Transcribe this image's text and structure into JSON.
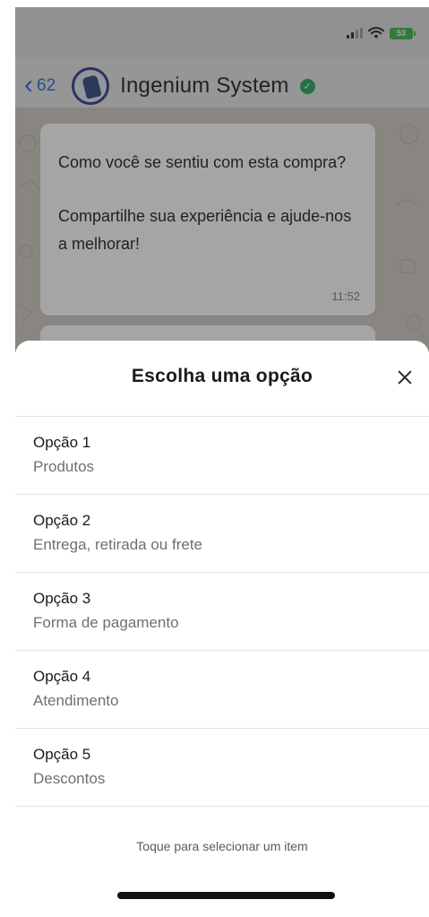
{
  "status_bar": {
    "battery_label": "53"
  },
  "header": {
    "back_count": "62",
    "contact_name": "Ingenium System"
  },
  "message": {
    "line1": "Como você se sentiu com esta compra?",
    "line2": "Compartilhe sua experiência e ajude-nos a melhorar!",
    "time": "11:52"
  },
  "sheet": {
    "title": "Escolha uma opção",
    "options": [
      {
        "label": "Opção 1",
        "description": "Produtos"
      },
      {
        "label": "Opção 2",
        "description": "Entrega, retirada ou frete"
      },
      {
        "label": "Opção 3",
        "description": "Forma de pagamento"
      },
      {
        "label": "Opção 4",
        "description": "Atendimento"
      },
      {
        "label": "Opção 5",
        "description": "Descontos"
      }
    ],
    "hint": "Toque para selecionar um item"
  },
  "icons": {
    "back": "chevron-left-icon",
    "verified": "verified-check-icon",
    "close": "close-icon",
    "signal": "signal-icon",
    "wifi": "wifi-icon",
    "battery": "battery-icon"
  },
  "colors": {
    "link_blue": "#1c6fd8",
    "verified_green": "#25a55a",
    "battery_green": "#3bb34a"
  }
}
